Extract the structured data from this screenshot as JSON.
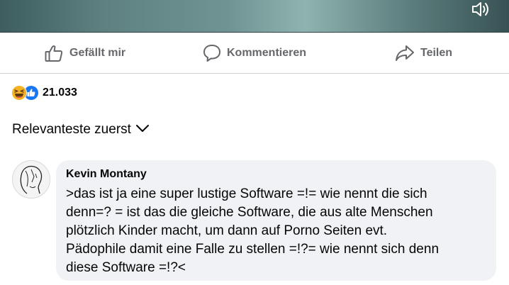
{
  "actions": {
    "like_label": "Gefällt mir",
    "comment_label": "Kommentieren",
    "share_label": "Teilen"
  },
  "reactions": {
    "icons": [
      "laugh-emoji-icon",
      "like-emoji-icon"
    ],
    "count": "21.033"
  },
  "sort": {
    "label": "Relevanteste zuerst"
  },
  "comment": {
    "author": "Kevin Montany",
    "text": ">das ist ja eine super lustige Software =!= wie nennt die sich\ndenn=? = ist das die gleiche Software, die aus alte Menschen\nplötzlich Kinder macht, um dann auf Porno Seiten evt.\nPädophile damit  eine Falle zu stellen =!?= wie nennt sich denn\ndiese Software =!?<"
  },
  "colors": {
    "bubble_bg": "#f0f2f5",
    "secondary_text": "#65676b",
    "like_blue": "#1877f2",
    "haha_yellow": "#f7b125"
  }
}
